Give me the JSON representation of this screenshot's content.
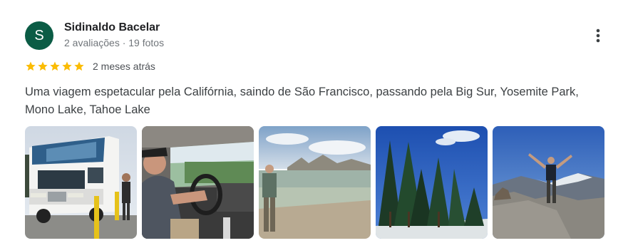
{
  "review": {
    "author": {
      "initial": "S",
      "name": "Sidinaldo Bacelar",
      "meta": "2 avaliações · 19 fotos",
      "avatar_color": "#0b5c45"
    },
    "rating": 5,
    "star_color": "#fbbc04",
    "date": "2 meses atrás",
    "text": "Uma viagem espetacular pela Califórnia, saindo de São Francisco, passando pela Big Sur, Yosemite Park, Mono Lake, Tahoe Lake",
    "more_icon": "more-vert-icon",
    "photos": [
      {
        "id": "photo-rv",
        "description": "motorhome"
      },
      {
        "id": "photo-driver",
        "description": "driving"
      },
      {
        "id": "photo-lake",
        "description": "lake shore"
      },
      {
        "id": "photo-forest",
        "description": "pine trees"
      },
      {
        "id": "photo-summit",
        "description": "summit"
      }
    ]
  }
}
